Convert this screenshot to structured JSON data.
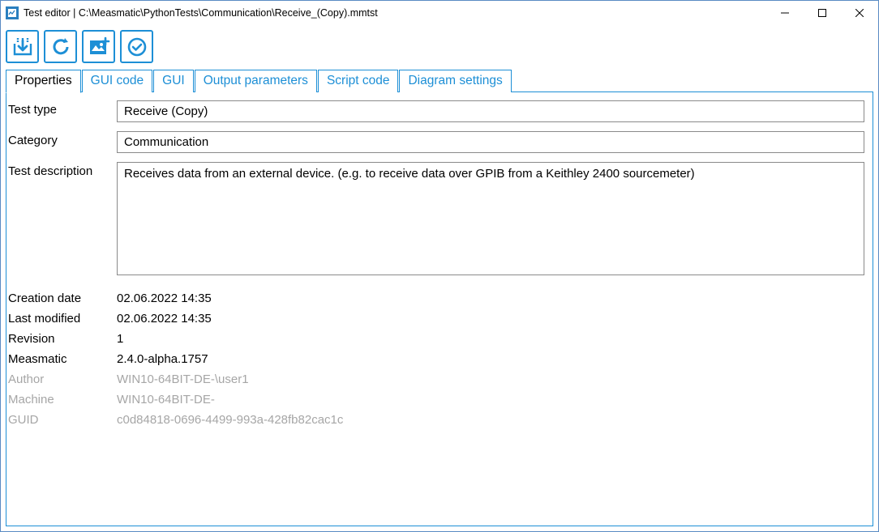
{
  "window": {
    "title": "Test editor | C:\\Measmatic\\PythonTests\\Communication\\Receive_(Copy).mmtst"
  },
  "tabs": {
    "properties": "Properties",
    "gui_code": "GUI code",
    "gui": "GUI",
    "output_parameters": "Output parameters",
    "script_code": "Script code",
    "diagram_settings": "Diagram settings"
  },
  "labels": {
    "test_type": "Test type",
    "category": "Category",
    "test_description": "Test description",
    "creation_date": "Creation date",
    "last_modified": "Last modified",
    "revision": "Revision",
    "measmatic": "Measmatic",
    "author": "Author",
    "machine": "Machine",
    "guid": "GUID"
  },
  "fields": {
    "test_type": "Receive (Copy)",
    "category": "Communication",
    "test_description": "Receives data from an external device. (e.g. to receive data over GPIB from a Keithley 2400 sourcemeter)",
    "creation_date": "02.06.2022 14:35",
    "last_modified": "02.06.2022 14:35",
    "revision": "1",
    "measmatic": "2.4.0-alpha.1757",
    "author": "WIN10-64BIT-DE-\\user1",
    "machine": "WIN10-64BIT-DE-",
    "guid": "c0d84818-0696-4499-993a-428fb82cac1c"
  }
}
